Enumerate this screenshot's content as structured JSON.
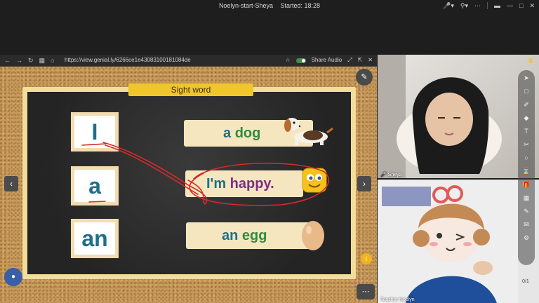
{
  "window": {
    "title_parts": [
      "Noelyn-start-Sheya",
      "Started: 18:28"
    ],
    "icons": [
      "mic-icon",
      "location-icon",
      "camera-icon",
      "minimize-icon",
      "maximize-icon",
      "close-icon"
    ]
  },
  "browser": {
    "url": "https://view.genial.ly/6266ce1e43083100181084de",
    "share_audio_label": "Share Audio"
  },
  "lesson": {
    "title": "Sight word",
    "words": [
      "I",
      "a",
      "an"
    ],
    "sentences": [
      {
        "prefix": "a ",
        "word": "dog"
      },
      {
        "prefix": "I'm ",
        "word": "happy."
      },
      {
        "prefix": "an ",
        "word": "egg"
      }
    ]
  },
  "video": {
    "student_label": "Sheya",
    "teacher_label": "Teacher Noelyn",
    "page_counter": "0/1"
  },
  "colors": {
    "accent_yellow": "#f0c62d",
    "word_blue": "#1f6f8b",
    "word_green": "#2f8c3d",
    "ink_red": "#d22b2b"
  }
}
